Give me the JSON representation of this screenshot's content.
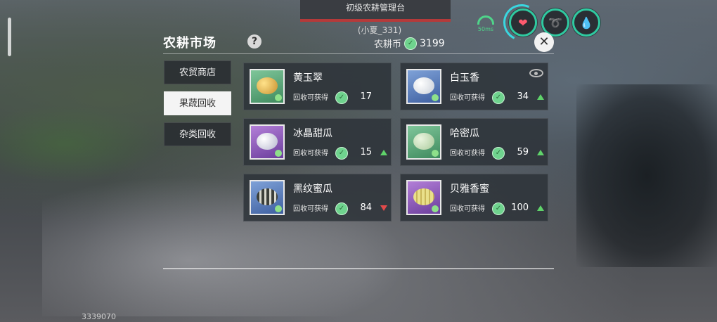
{
  "top_banner": {
    "title": "初级农耕管理台"
  },
  "player": {
    "name": "(小夏_331)"
  },
  "ping": {
    "label": "50ms"
  },
  "status_icons": {
    "health": "heart-icon",
    "hunger": "food-icon",
    "water": "water-drop-icon"
  },
  "panel": {
    "title": "农耕市场",
    "help": "?"
  },
  "currency": {
    "label": "农耕币",
    "value": "3199"
  },
  "tabs": [
    {
      "label": "农贸商店",
      "active": false
    },
    {
      "label": "果蔬回收",
      "active": true
    },
    {
      "label": "杂类回收",
      "active": false
    }
  ],
  "items": [
    {
      "name": "黄玉翠",
      "recycle_label": "回收可获得",
      "reward": "17",
      "trend": "none",
      "thumb": "green",
      "fruit": "gold"
    },
    {
      "name": "白玉香",
      "recycle_label": "回收可获得",
      "reward": "34",
      "trend": "up",
      "thumb": "blue",
      "fruit": "white"
    },
    {
      "name": "冰晶甜瓜",
      "recycle_label": "回收可获得",
      "reward": "15",
      "trend": "up",
      "thumb": "purple",
      "fruit": "ice"
    },
    {
      "name": "哈密瓜",
      "recycle_label": "回收可获得",
      "reward": "59",
      "trend": "up",
      "thumb": "green",
      "fruit": "honeydew"
    },
    {
      "name": "黑纹蜜瓜",
      "recycle_label": "回收可获得",
      "reward": "84",
      "trend": "down",
      "thumb": "blue",
      "fruit": "striped"
    },
    {
      "name": "贝雅香蜜",
      "recycle_label": "回收可获得",
      "reward": "100",
      "trend": "up",
      "thumb": "purple",
      "fruit": "yellow"
    }
  ],
  "footer": {
    "id": "3339070"
  },
  "colors": {
    "trend_up": "#5fd36a",
    "trend_down": "#e24a4a",
    "accent": "#2fc9a0"
  }
}
